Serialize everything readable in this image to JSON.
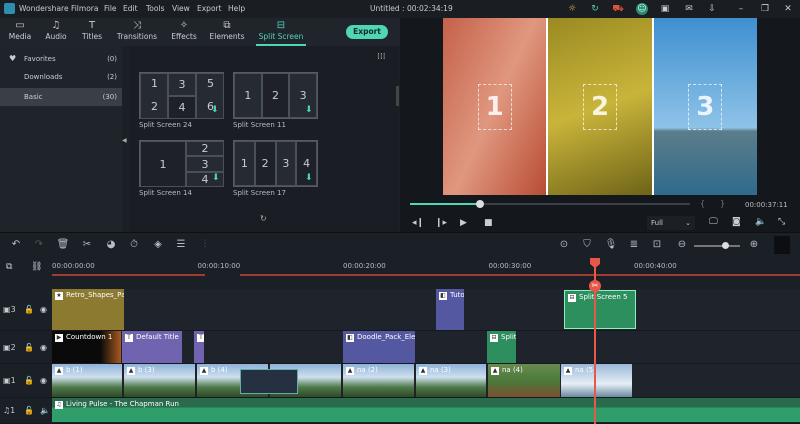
{
  "app": {
    "name": "Wondershare Filmora",
    "menu": [
      "File",
      "Edit",
      "Tools",
      "View",
      "Export",
      "Help"
    ],
    "project_title": "Untitled : 00:02:34:19",
    "window_icons": [
      "bulb-icon",
      "sync-icon",
      "cart-icon",
      "account-icon",
      "save-icon",
      "mail-icon",
      "download-icon",
      "minimize-icon",
      "restore-icon",
      "close-icon"
    ]
  },
  "tabs": [
    {
      "label": "Media",
      "icon": "folder-icon",
      "glyph": "▭"
    },
    {
      "label": "Audio",
      "icon": "music-icon",
      "glyph": "♫"
    },
    {
      "label": "Titles",
      "icon": "text-icon",
      "glyph": "T"
    },
    {
      "label": "Transitions",
      "icon": "transition-icon",
      "glyph": "⤨"
    },
    {
      "label": "Effects",
      "icon": "effects-icon",
      "glyph": "✧"
    },
    {
      "label": "Elements",
      "icon": "elements-icon",
      "glyph": "⧉"
    },
    {
      "label": "Split Screen",
      "icon": "split-screen-icon",
      "glyph": "⊟",
      "active": true
    }
  ],
  "export_label": "Export",
  "sidebar": {
    "items": [
      {
        "label": "Favorites",
        "count": "(0)",
        "icon": "heart-icon"
      },
      {
        "label": "Downloads",
        "count": "(2)"
      },
      {
        "label": "Basic",
        "count": "(30)",
        "selected": true
      }
    ]
  },
  "presets": [
    {
      "name": "Split Screen 24",
      "cells": [
        "1",
        "3",
        "5",
        "2",
        "4",
        "6"
      ]
    },
    {
      "name": "Split Screen 11",
      "cells": [
        "1",
        "2",
        "3"
      ]
    },
    {
      "name": "Split Screen 14",
      "cells": [
        "1",
        "2",
        "3",
        "4"
      ]
    },
    {
      "name": "Split Screen 17",
      "cells": [
        "1",
        "2",
        "3",
        "4"
      ]
    }
  ],
  "preview": {
    "panes": [
      "1",
      "2",
      "3"
    ],
    "timecode": "00:00:37:11",
    "progress": 0.25,
    "quality": "Full",
    "mark_in": "{",
    "mark_out": "}"
  },
  "ruler": {
    "labels": [
      "00:00:00:00",
      "00:00:10:00",
      "00:00:20:00",
      "00:00:30:00",
      "00:00:40:00"
    ]
  },
  "tracks": {
    "v3": {
      "label": "3",
      "clips": [
        {
          "name": "Retro_Shapes_Par",
          "type": "element"
        },
        {
          "name": "Tuto",
          "type": "element"
        },
        {
          "name": "Split Screen 5",
          "type": "split"
        }
      ]
    },
    "v2": {
      "label": "2",
      "clips": [
        {
          "name": "Countdown 1",
          "type": "video"
        },
        {
          "name": "Default Title",
          "type": "title"
        },
        {
          "name": "",
          "type": "title"
        },
        {
          "name": "Doodle_Pack_Elen",
          "type": "element"
        },
        {
          "name": "Split",
          "type": "split"
        }
      ]
    },
    "v1": {
      "label": "1",
      "clips": [
        "b (1)",
        "b (3)",
        "b (4)",
        "",
        "na (2)",
        "na (3)",
        "na (4)",
        "na (5)"
      ]
    },
    "a1": {
      "label": "1",
      "clips": [
        "Living Pulse - The Chapman Run"
      ]
    }
  },
  "colors": {
    "accent": "#4fd6b4",
    "playhead": "#e8574a",
    "title_clip": "#7064b0",
    "element_clip": "#5458a0",
    "retro_clip": "#8c7a30",
    "split_clip": "#2e8f5e",
    "audio": "#2f9e6a"
  }
}
